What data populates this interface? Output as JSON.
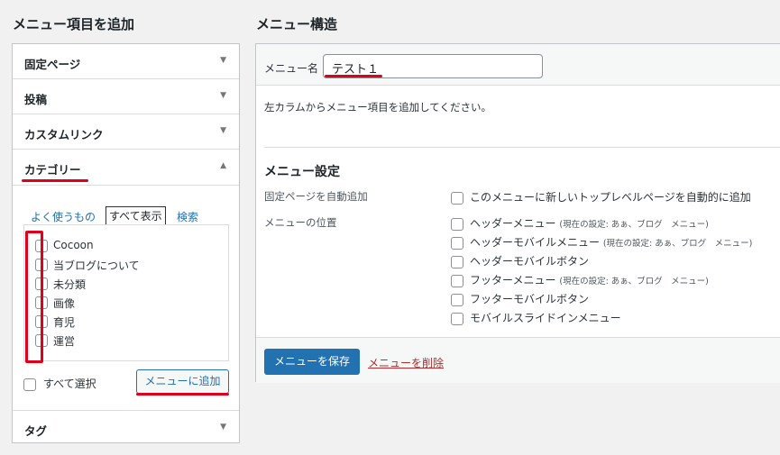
{
  "left_panel": {
    "title": "メニュー項目を追加",
    "sections": [
      {
        "label": "固定ページ"
      },
      {
        "label": "投稿"
      },
      {
        "label": "カスタムリンク"
      },
      {
        "label": "カテゴリー"
      },
      {
        "label": "タグ"
      }
    ],
    "category": {
      "tabs": [
        "よく使うもの",
        "すべて表示",
        "検索"
      ],
      "items": [
        "Cocoon",
        "当ブログについて",
        "未分類",
        "画像",
        "育児",
        "運営"
      ],
      "select_all_label": "すべて選択",
      "add_button_label": "メニューに追加"
    }
  },
  "right_panel": {
    "title": "メニュー構造",
    "menu_name_label": "メニュー名",
    "menu_name_value": "テスト１",
    "instructions": "左カラムからメニュー項目を追加してください。",
    "settings_title": "メニュー設定",
    "auto_add_label": "固定ページを自動追加",
    "auto_add_option": "このメニューに新しいトップレベルページを自動的に追加",
    "location_label": "メニューの位置",
    "locations": [
      {
        "name": "ヘッダーメニュー",
        "note": "(現在の設定: あぁ、ブログ　メニュー)"
      },
      {
        "name": "ヘッダーモバイルメニュー",
        "note": "(現在の設定: あぁ、ブログ　メニュー)"
      },
      {
        "name": "ヘッダーモバイルボタン",
        "note": ""
      },
      {
        "name": "フッターメニュー",
        "note": "(現在の設定: あぁ、ブログ　メニュー)"
      },
      {
        "name": "フッターモバイルボタン",
        "note": ""
      },
      {
        "name": "モバイルスライドインメニュー",
        "note": ""
      }
    ],
    "save_button_label": "メニューを保存",
    "delete_link_label": "メニューを削除"
  },
  "icons": {
    "collapsed": "triangle-down-icon",
    "expanded": "triangle-up-icon"
  },
  "colors": {
    "accent": "#2271b1",
    "highlight_red": "#e0001b",
    "delete_red": "#b32d2e"
  }
}
